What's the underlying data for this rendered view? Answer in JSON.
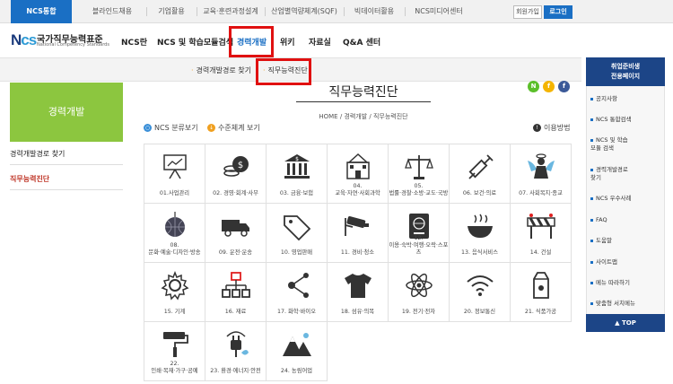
{
  "topbar": {
    "tabs": [
      "NCS통합",
      "블라인드채용",
      "기업활용",
      "교육·훈련과정설계",
      "산업별역량체계(SQF)",
      "빅데이터활용",
      "NCS미디어센터"
    ],
    "join_label": "회원가입",
    "login_label": "로그인",
    "active_color": "#1a6fc4"
  },
  "logo": {
    "mark_n": "N",
    "mark_cs": "cs",
    "korean": "국가직무능력표준",
    "english": "National Competency Standards"
  },
  "gnb": {
    "items": [
      "NCS란",
      "NCS 및 학습모듈검색",
      "경력개발",
      "위키",
      "자료실",
      "Q&A 센터"
    ],
    "active": "경력개발"
  },
  "subnav": {
    "items": [
      "경력개발경로 찾기",
      "직무능력진단"
    ]
  },
  "left": {
    "banner": "경력개발",
    "menu": [
      "경력개발경로 찾기",
      "직무능력진단"
    ],
    "banner_color": "#8cc63f"
  },
  "social": [
    "N",
    "f",
    "f"
  ],
  "page": {
    "title": "직무능력진단",
    "breadcrumb": "HOME / 경력개발 / 직무능력진단"
  },
  "tools": {
    "classification": "NCS 분류보기",
    "level_system": "수준체계 보기",
    "usage": "이용방법"
  },
  "categories": [
    {
      "label": "01.사업관리",
      "icon": "presentation-board-icon"
    },
    {
      "label": "02. 경영·회계·사무",
      "icon": "coins-icon"
    },
    {
      "label": "03. 금융·보험",
      "icon": "bank-icon"
    },
    {
      "label": "04.\n교육·자연·사회과학",
      "icon": "school-building-icon"
    },
    {
      "label": "05.\n법률·경찰·소방·교도·국방",
      "icon": "scales-icon"
    },
    {
      "label": "06. 보건·의료",
      "icon": "syringe-icon"
    },
    {
      "label": "07. 사회복지·종교",
      "icon": "angel-icon"
    },
    {
      "label": "08.\n문화·예술·디자인·방송",
      "icon": "disco-ball-icon"
    },
    {
      "label": "09. 운전·운송",
      "icon": "delivery-truck-icon"
    },
    {
      "label": "10. 영업판매",
      "icon": "price-tag-icon"
    },
    {
      "label": "11. 경비·청소",
      "icon": "cctv-camera-icon"
    },
    {
      "label": "12.\n이용·숙박·여행·오락·스포츠",
      "icon": "passport-icon"
    },
    {
      "label": "13. 음식서비스",
      "icon": "food-bowl-icon"
    },
    {
      "label": "14. 건설",
      "icon": "construction-barrier-icon"
    },
    {
      "label": "15. 기계",
      "icon": "gear-icon"
    },
    {
      "label": "16. 재료",
      "icon": "structure-icon"
    },
    {
      "label": "17. 화학·바이오",
      "icon": "molecule-icon"
    },
    {
      "label": "18. 섬유·의복",
      "icon": "t-shirt-icon"
    },
    {
      "label": "19. 전기·전자",
      "icon": "atom-icon"
    },
    {
      "label": "20. 정보통신",
      "icon": "wifi-icon"
    },
    {
      "label": "21. 식품가공",
      "icon": "milk-carton-icon"
    },
    {
      "label": "22.\n인쇄·목재·가구·공예",
      "icon": "paint-roller-icon"
    },
    {
      "label": "23. 환경·에너지·안전",
      "icon": "eco-plug-icon"
    },
    {
      "label": "24. 농림어업",
      "icon": "mountains-icon"
    }
  ],
  "right": {
    "heading_line1": "취업준비생",
    "heading_line2": "전용페이지",
    "items": [
      "공지사항",
      "NCS 통합검색",
      "NCS 및 학습\n모듈 검색",
      "경력개발경로\n찾기",
      "NCS 우수사례",
      "FAQ",
      "도움말",
      "사이트맵",
      "메뉴 따라하기",
      "맞춤형 서치메뉴"
    ],
    "top_label": "TOP",
    "heading_color": "#1c4587"
  }
}
